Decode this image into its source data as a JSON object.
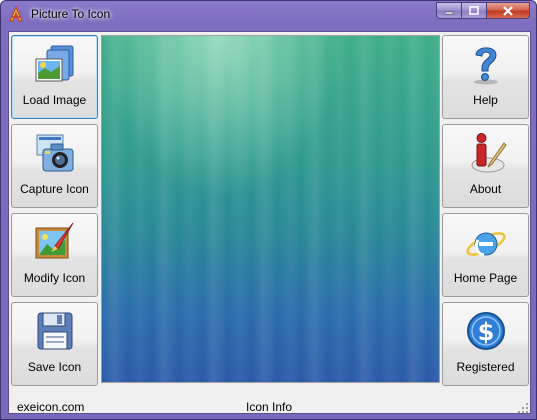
{
  "window": {
    "title": "Picture To Icon"
  },
  "buttons_left": [
    {
      "label": "Load Image",
      "icon": "image-folder-icon"
    },
    {
      "label": "Capture Icon",
      "icon": "camera-capture-icon"
    },
    {
      "label": "Modify Icon",
      "icon": "paint-brush-icon"
    },
    {
      "label": "Save Icon",
      "icon": "floppy-disk-icon"
    }
  ],
  "buttons_right": [
    {
      "label": "Help",
      "icon": "question-mark-icon"
    },
    {
      "label": "About",
      "icon": "about-info-icon"
    },
    {
      "label": "Home Page",
      "icon": "internet-explorer-icon"
    },
    {
      "label": "Registered",
      "icon": "dollar-coin-icon"
    }
  ],
  "status": {
    "website": "exeicon.com",
    "info": "Icon Info"
  },
  "colors": {
    "titlebar": "#7f6dbf",
    "client": "#f0f0f0",
    "close": "#c0391f",
    "preview_top": "#3fae8a",
    "preview_bottom": "#2b5aa8"
  }
}
